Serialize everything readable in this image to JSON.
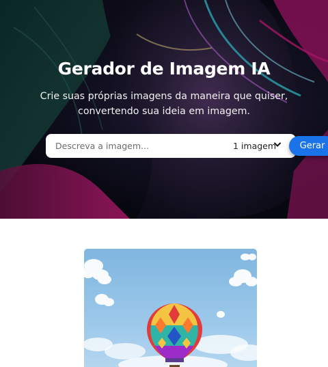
{
  "hero": {
    "title": "Gerador de Imagem IA",
    "subtitle_line1": "Crie suas próprias imagens da maneira que quiser,",
    "subtitle_line2": "convertendo sua ideia em imagem."
  },
  "search": {
    "placeholder": "Descreva a imagem...",
    "value": "",
    "image_count": {
      "selected": "1 imagem"
    },
    "generate_label": "Gerar"
  },
  "colors": {
    "accent": "#1a73e8",
    "hero_neon_pink": "#e0208a",
    "hero_neon_cyan": "#39d5e8"
  },
  "gallery": {
    "images": [
      {
        "subject": "colorful hot air balloon in blue sky"
      }
    ]
  }
}
